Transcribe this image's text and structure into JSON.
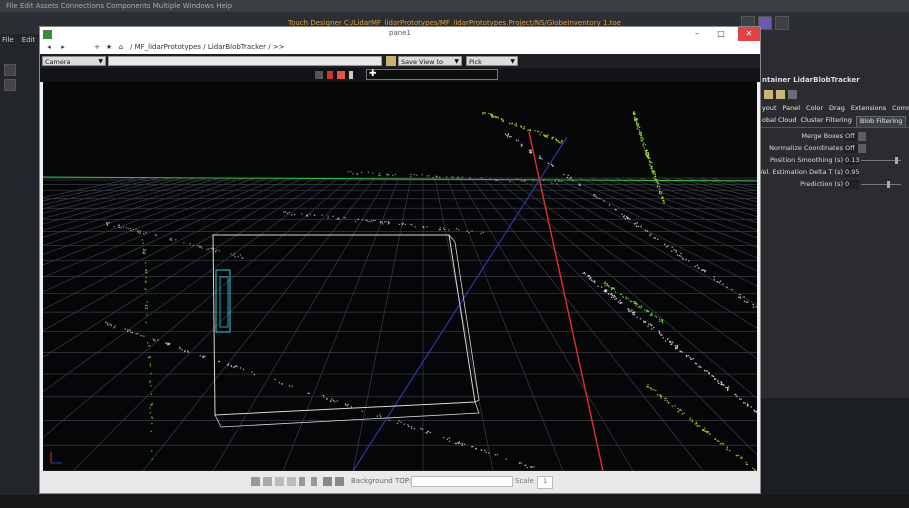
{
  "host": {
    "menubar": "File  Edit  Assets  Connections  Components  Multiple  Windows  Help",
    "titlebar": "Touch Designer  C:/LidarMF_lidarPrototypes/MF_lidarPrototypes.Project/NS/GlobeInventory 1.toe",
    "left_tabs": [
      "File",
      "Edit"
    ]
  },
  "viewer": {
    "title": "pane1",
    "minimize": "–",
    "maximize": "□",
    "close": "✕",
    "nav_back": "◂",
    "nav_forward": "▸",
    "nav_add": "+",
    "nav_star": "★",
    "nav_home": "⌂",
    "breadcrumb": "/  MF_lidarPrototypes  /  LidarBlobTracker  /  >>",
    "camera_select": "Camera",
    "save_view": "Save View to",
    "pick_mode": "Pick",
    "command_text": "✚",
    "status": {
      "background_label": "Background TOP:",
      "scale_label": "Scale",
      "scale_value": "1"
    }
  },
  "param_panel": {
    "title": "ntainer  LidarBlobTracker",
    "tabs_top": [
      "yout",
      "Panel",
      "Color",
      "Drag",
      "Extensions",
      "Comm"
    ],
    "tabs_sub": [
      "obal Cloud",
      "Cluster Filtering",
      "Blob Filtering",
      "Cl"
    ],
    "active_sub_tab": "Blob Filtering",
    "params": [
      {
        "label": "Merge Boxes",
        "value": "Off",
        "kind": "toggle"
      },
      {
        "label": "Normalize Coordinates",
        "value": "Off",
        "kind": "toggle"
      },
      {
        "label": "Position Smoothing (s)",
        "value": "0.13",
        "kind": "slider",
        "level": 0.84
      },
      {
        "label": "Vel. Estimation Delta T (s)",
        "value": "0.95",
        "kind": "field"
      },
      {
        "label": "Prediction (s)",
        "value": "0",
        "kind": "slider",
        "level": 0.65
      }
    ]
  },
  "colors": {
    "viewport_bg": "#050608",
    "grid": "#3a3d44",
    "horizon_line": "#3bbf3b",
    "axis_red": "#e03030",
    "axis_blue": "#3a3acc",
    "blob_box": "#2fd0d8",
    "points": "#a8c830"
  }
}
